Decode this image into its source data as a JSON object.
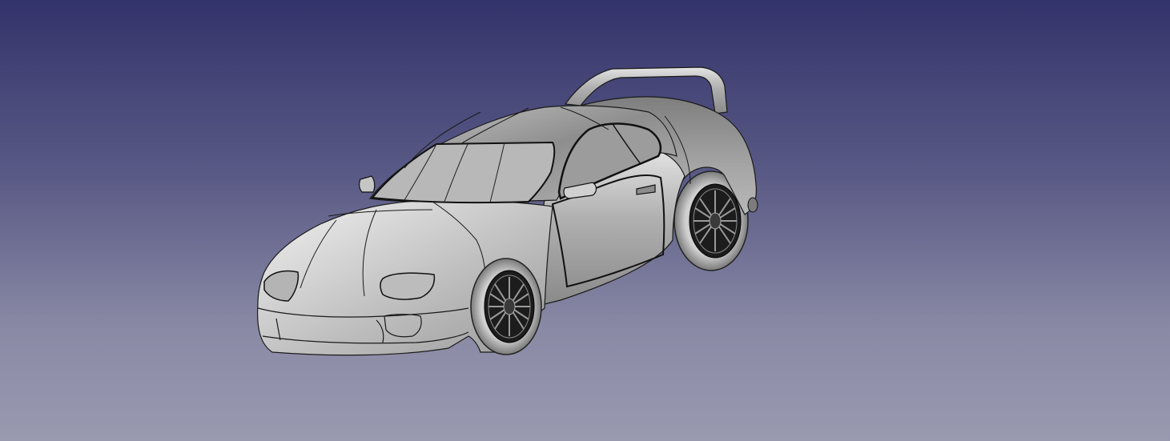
{
  "viewport": {
    "background_top": "#33336b",
    "background_bottom": "#9999b0"
  },
  "model": {
    "object": "sports-car-3d-model",
    "display_mode": "shaded-with-edges",
    "body_color": "#a8a8a8",
    "edge_color": "#1a1a1a"
  }
}
